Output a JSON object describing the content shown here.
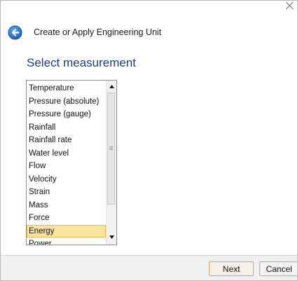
{
  "window": {
    "title": "Create or Apply Engineering Unit",
    "close_icon": "close-icon",
    "back_icon": "back-arrow-icon"
  },
  "main": {
    "heading": "Select measurement",
    "measurement_list": {
      "items": [
        "Temperature",
        "Pressure (absolute)",
        "Pressure (gauge)",
        "Rainfall",
        "Rainfall rate",
        "Water level",
        "Flow",
        "Velocity",
        "Strain",
        "Mass",
        "Force",
        "Energy",
        "Power"
      ],
      "selected": "Energy",
      "scroll_up_icon": "scroll-up-arrow-icon",
      "scroll_down_icon": "scroll-down-arrow-icon"
    }
  },
  "footer": {
    "next_label": "Next",
    "cancel_label": "Cancel"
  },
  "colors": {
    "heading": "#1f3d7a",
    "back_button": "#1d63b8",
    "selection_fill": "#fbe3a0",
    "selection_border": "#e8b84a",
    "footer_bg": "#f0f0f0",
    "next_border": "#d9a45c"
  }
}
